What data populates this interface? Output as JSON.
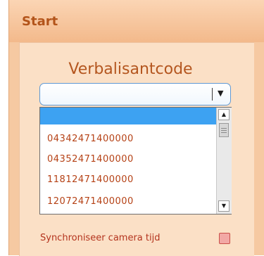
{
  "panel": {
    "title": "Start"
  },
  "verbalisant": {
    "label": "Verbalisantcode",
    "value": "",
    "options": [
      "",
      "04342471400000",
      "04352471400000",
      "11812471400000",
      "12072471400000"
    ]
  },
  "sync_camera": {
    "label": "Synchroniseer camera tijd",
    "checked": false
  },
  "icons": {
    "combo_arrow": "triangle-down",
    "scroll_up": "triangle-up",
    "scroll_down": "triangle-down"
  },
  "colors": {
    "panel": "#f6c9a2",
    "title": "#b3541a",
    "selection": "#3da2f2",
    "option_text": "#b54115"
  }
}
